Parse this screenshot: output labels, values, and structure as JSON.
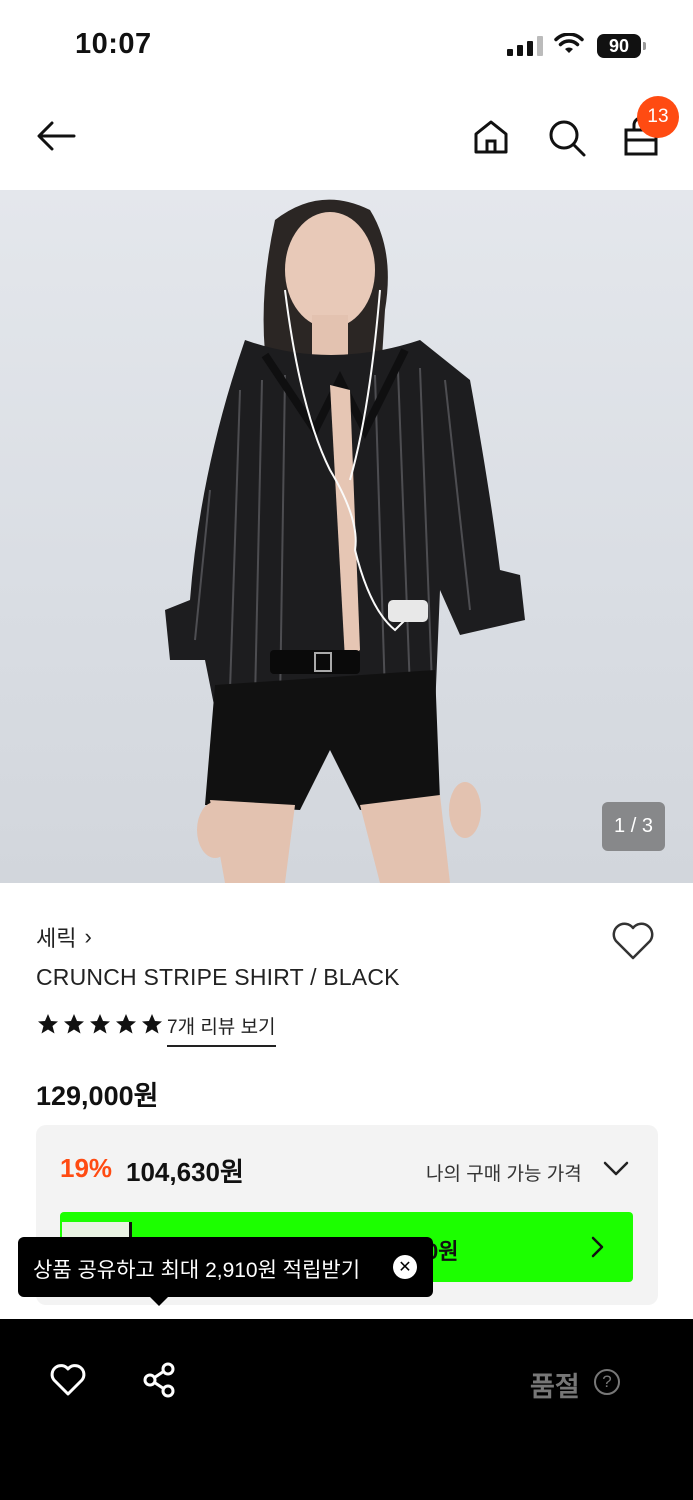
{
  "status_bar": {
    "time": "10:07",
    "battery": "90"
  },
  "nav": {
    "back_icon": "arrow-left-icon",
    "home_icon": "home-icon",
    "search_icon": "search-icon",
    "bag_icon": "shopping-bag-icon",
    "cart_count": "13"
  },
  "gallery": {
    "counter": "1 / 3"
  },
  "product": {
    "brand": "세릭",
    "brand_chevron": "›",
    "name": "CRUNCH STRIPE SHIRT / BLACK",
    "rating_stars": 5,
    "review_link": "7개 리뷰 보기",
    "price": "129,000원"
  },
  "discount": {
    "percent": "19%",
    "sale_price": "104,630원",
    "my_price_label": "나의 구매 가능 가격",
    "promo_partial": "0원"
  },
  "tooltip": {
    "text": "상품 공유하고 최대 2,910원 적립받기"
  },
  "bottom": {
    "soldout": "품절",
    "help": "?"
  },
  "colors": {
    "accent": "#ff4b12",
    "promo": "#1cff00",
    "bar": "#000000"
  }
}
